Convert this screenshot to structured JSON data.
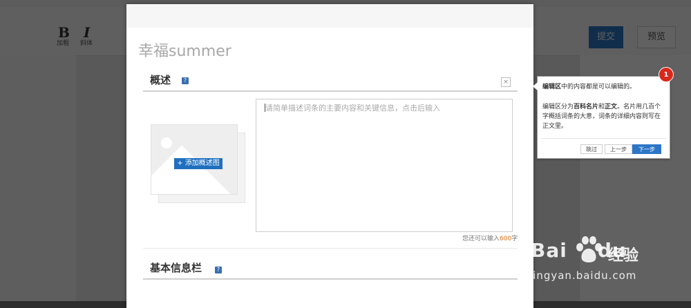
{
  "modal": {
    "title": "幸福summer",
    "sections": {
      "summary": {
        "title": "概述",
        "help": "?",
        "close": "×"
      },
      "basic_info": {
        "title": "基本信息栏",
        "help": "?"
      }
    },
    "add_image_label": "+ 添加概述图",
    "textarea_placeholder": "请简单描述词条的主要内容和关键信息，点击后输入",
    "counter": {
      "prefix": "您还可以输入",
      "count": "600",
      "suffix": "字"
    }
  },
  "toolbar": {
    "bold": "B",
    "italic": "I",
    "bold_label": "加粗",
    "italic_label": "斜体",
    "submit": "提交",
    "preview": "预览"
  },
  "tooltip": {
    "step": "1",
    "line1": {
      "b": "编辑区",
      "rest": "中的内容都是可以编辑的。"
    },
    "line2": {
      "a": "编辑区分为",
      "b1": "百科名片",
      "c": "和",
      "b2": "正文",
      "d": "。名片用几百个字概括词条的大意，词条的详细内容则写在正文里。"
    },
    "skip": "跳过",
    "prev": "上一步",
    "next": "下一步"
  },
  "watermark": {
    "brand": "Bai",
    "brand2": "du",
    "cn": "经验",
    "url": "jingyan.baidu.com"
  },
  "colors": {
    "accent": "#2c76c8",
    "badge": "#d9291c",
    "counter_num": "#e2711d"
  }
}
